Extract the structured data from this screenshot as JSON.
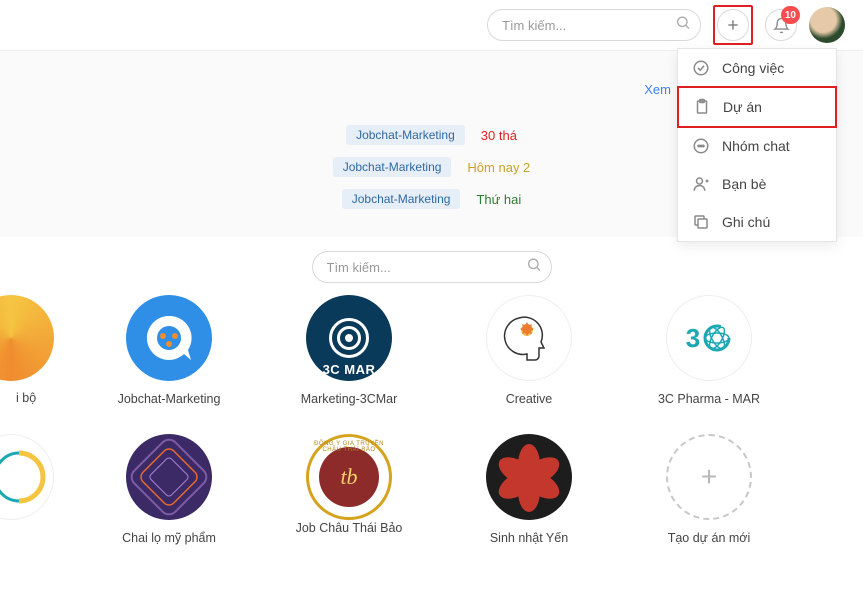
{
  "header": {
    "search_placeholder": "Tìm kiếm...",
    "notification_count": "10"
  },
  "dropdown": {
    "items": [
      {
        "label": "Công việc",
        "icon": "check-circle"
      },
      {
        "label": "Dự án",
        "icon": "clipboard",
        "highlighted": true
      },
      {
        "label": "Nhóm chat",
        "icon": "chat-bubble"
      },
      {
        "label": "Bạn bè",
        "icon": "user-plus"
      },
      {
        "label": "Ghi chú",
        "icon": "copy"
      }
    ]
  },
  "feed": {
    "view_all_label": "Xem",
    "rows": [
      {
        "tag": "Jobchat-Marketing",
        "date": "30 thá",
        "style": "red"
      },
      {
        "tag": "Jobchat-Marketing",
        "date": "Hôm nay 2",
        "style": "gold"
      },
      {
        "tag": "Jobchat-Marketing",
        "date": "Thứ hai",
        "style": "green"
      }
    ]
  },
  "mid_search": {
    "placeholder": "Tìm kiếm..."
  },
  "projects_row1_partial_label": "i bộ",
  "projects": {
    "row1": [
      {
        "label": "Jobchat-Marketing",
        "logo": "chat"
      },
      {
        "label": "Marketing-3CMar",
        "logo": "3cmar",
        "sublabel": "3C MAR"
      },
      {
        "label": "Creative",
        "logo": "creative"
      },
      {
        "label": "3C Pharma - MAR",
        "logo": "3c"
      }
    ],
    "row2_partial_label": "",
    "row2": [
      {
        "label": "Chai lọ mỹ phẩm",
        "logo": "diamond"
      },
      {
        "label": "Job Châu Thái Bảo",
        "logo": "seal",
        "seal_text": "tb"
      },
      {
        "label": "Sinh nhật Yến",
        "logo": "flower"
      },
      {
        "label": "Tạo dự án mới",
        "logo": "new"
      }
    ]
  }
}
